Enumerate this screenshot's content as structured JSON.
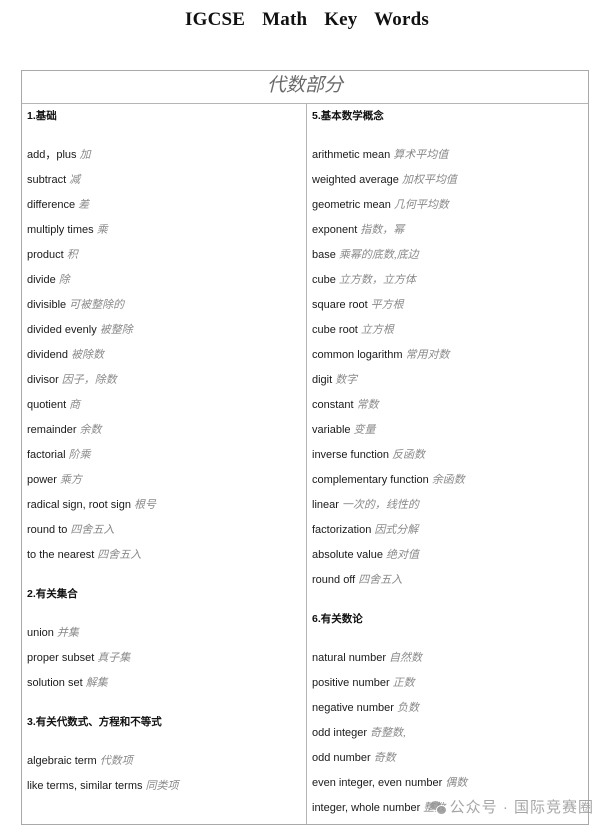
{
  "document": {
    "title": "IGCSE    Math    Key    Words"
  },
  "table": {
    "header": "代数部分",
    "left_column": {
      "sections": [
        {
          "title": "1.基础",
          "entries": [
            {
              "en": "add，plus",
              "zh": "加"
            },
            {
              "en": "subtract",
              "zh": "减"
            },
            {
              "en": "difference",
              "zh": "差"
            },
            {
              "en": "multiply times",
              "zh": "乘"
            },
            {
              "en": "product",
              "zh": "积"
            },
            {
              "en": "divide",
              "zh": "除"
            },
            {
              "en": "divisible",
              "zh": "可被整除的"
            },
            {
              "en": "divided evenly",
              "zh": "被整除"
            },
            {
              "en": "dividend",
              "zh": "被除数"
            },
            {
              "en": "divisor",
              "zh": "因子，除数"
            },
            {
              "en": "quotient",
              "zh": "商"
            },
            {
              "en": "remainder",
              "zh": "余数"
            },
            {
              "en": "factorial",
              "zh": "阶乘"
            },
            {
              "en": "power",
              "zh": "乘方"
            },
            {
              "en": "radical sign, root sign",
              "zh": "根号"
            },
            {
              "en": "round to",
              "zh": "四舍五入"
            },
            {
              "en": "to the nearest",
              "zh": "四舍五入"
            }
          ]
        },
        {
          "title": "2.有关集合",
          "entries": [
            {
              "en": "union",
              "zh": "并集"
            },
            {
              "en": "proper subset",
              "zh": "真子集"
            },
            {
              "en": "solution set",
              "zh": "解集"
            }
          ]
        },
        {
          "title": "3.有关代数式、方程和不等式",
          "entries": [
            {
              "en": "algebraic term",
              "zh": "代数项"
            },
            {
              "en": "like terms, similar terms",
              "zh": "同类项"
            }
          ]
        }
      ]
    },
    "right_column": {
      "sections": [
        {
          "title": "5.基本数学概念",
          "entries": [
            {
              "en": "arithmetic mean",
              "zh": "算术平均值"
            },
            {
              "en": "weighted average",
              "zh": "加权平均值"
            },
            {
              "en": "geometric mean",
              "zh": "几何平均数"
            },
            {
              "en": "exponent",
              "zh": "指数，幂"
            },
            {
              "en": "base",
              "zh": "乘幂的底数,底边"
            },
            {
              "en": "cube",
              "zh": "立方数，立方体"
            },
            {
              "en": "square root",
              "zh": "平方根"
            },
            {
              "en": "cube root",
              "zh": "立方根"
            },
            {
              "en": "common logarithm",
              "zh": "常用对数"
            },
            {
              "en": "digit",
              "zh": "数字"
            },
            {
              "en": "constant",
              "zh": "常数"
            },
            {
              "en": "variable",
              "zh": "变量"
            },
            {
              "en": "inverse function",
              "zh": "反函数"
            },
            {
              "en": "complementary function",
              "zh": "余函数"
            },
            {
              "en": "linear",
              "zh": "一次的，线性的"
            },
            {
              "en": "factorization",
              "zh": "因式分解"
            },
            {
              "en": "absolute value",
              "zh": "绝对值"
            },
            {
              "en": "round off",
              "zh": "四舍五入"
            }
          ]
        },
        {
          "title": "6.有关数论",
          "entries": [
            {
              "en": "natural number",
              "zh": "自然数"
            },
            {
              "en": "positive number",
              "zh": "正数"
            },
            {
              "en": "negative number",
              "zh": "负数"
            },
            {
              "en": "odd integer",
              "zh": "奇整数,"
            },
            {
              "en": "odd number",
              "zh": "奇数"
            },
            {
              "en": "even integer, even number",
              "zh": "偶数"
            },
            {
              "en": "integer, whole number",
              "zh": "整数"
            }
          ]
        }
      ]
    }
  },
  "watermark": {
    "icon": "wechat-icon",
    "text": "公众号 · 国际竞赛圈"
  }
}
